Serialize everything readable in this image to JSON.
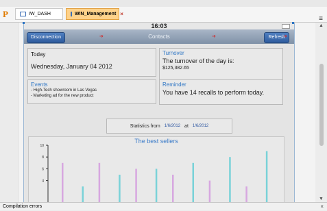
{
  "tabs": [
    {
      "label": "IW_DASH"
    },
    {
      "label": "WIN_Management"
    }
  ],
  "status": {
    "time": "16:03"
  },
  "nav": {
    "title": "Contacts",
    "left_button": "Disconnection",
    "right_button": "Refresh"
  },
  "today": {
    "title": "Today",
    "date": "Wednesday, January 04 2012"
  },
  "turnover": {
    "title": "Turnover",
    "text": "The turnover of the day is:",
    "value": "$125,382.65"
  },
  "events": {
    "title": "Events",
    "lines": [
      "- High-Tech showroom in Las Vegas",
      "- Marketing ad for the new product"
    ]
  },
  "reminder": {
    "title": "Reminder",
    "text": "You have 14 recalls to perform today."
  },
  "stats": {
    "label": "Statistics from",
    "from": "1/6/2012",
    "at": "at",
    "to": "1/6/2012"
  },
  "chart_data": {
    "type": "bar",
    "title": "The best sellers",
    "ylim": [
      0,
      10
    ],
    "yticks": [
      4,
      6,
      8,
      10
    ],
    "series": [
      {
        "color": "#d7a7e0",
        "values": [
          7,
          7,
          6,
          5,
          4,
          3
        ]
      },
      {
        "color": "#79d2d8",
        "values": [
          3,
          5,
          6,
          7,
          8,
          9
        ]
      }
    ]
  },
  "bottom": {
    "label": "Compilation errors"
  },
  "colors": {
    "accent": "#2b74c4",
    "tab_active": "#ffd28a"
  }
}
